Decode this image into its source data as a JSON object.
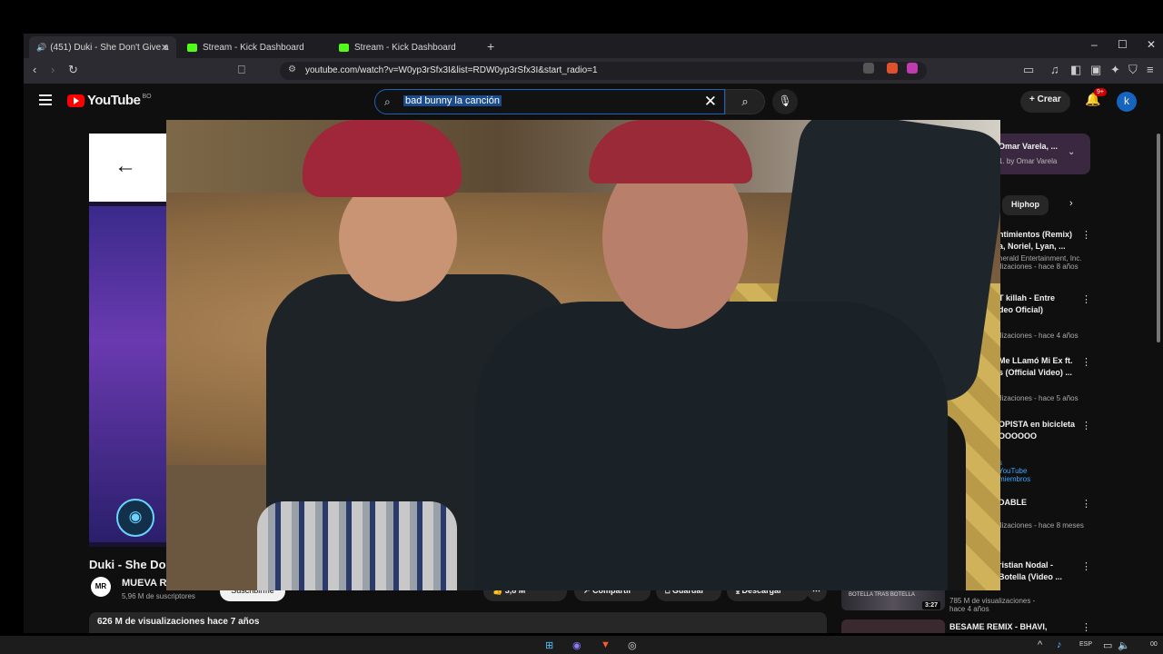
{
  "browser": {
    "tabs": [
      {
        "label": "(451) Duki - She Don't Give a",
        "icon": "youtube-icon",
        "active": true
      },
      {
        "label": "Stream - Kick Dashboard",
        "icon": "kick-icon"
      },
      {
        "label": "Stream - Kick Dashboard",
        "icon": "kick-icon"
      }
    ],
    "new_tab": "+",
    "url": "youtube.com/watch?v=W0yp3rSfx3I&list=RDW0yp3rSfx3I&start_radio=1",
    "window_controls": {
      "minimize": "–",
      "maximize": "☐",
      "close": "✕"
    }
  },
  "youtube": {
    "logo_text": "YouTube",
    "country_code": "BO",
    "search_query": "bad bunny la canción",
    "create_label": "Crear",
    "notif_badge": "9+",
    "avatar_letter": "k"
  },
  "video": {
    "title": "Duki - She Don",
    "channel": "MUEVA Re",
    "channel_logo": "MR",
    "subscribers": "5,96 M de suscriptores",
    "subscribe_label": "Suscribirme",
    "likes": "3,8 M",
    "share_label": "Compartir",
    "save_label": "Guardar",
    "download_label": "Descargar",
    "views_line": "626 M de visualizaciones  hace 7 años"
  },
  "sidebar": {
    "mix_title": "Omar Varela, ...",
    "mix_sub": "1. by Omar Varela",
    "chip": "Hiphop",
    "items": [
      {
        "title": "ntimientos (Remix)\na, Noriel, Lyan, ...",
        "meta": "herald Entertainment, Inc.\nilizaciones - hace 8 años"
      },
      {
        "title": "T killah - Entre\ndeo Oficial)",
        "meta": "ilizaciones - hace 4 años"
      },
      {
        "title": "Me LLamó Mi Ex ft.\ns (Official Video) ...",
        "meta": "ilizaciones - hace 5 años"
      },
      {
        "title": "OPISTA en bicicleta\nOOOOOO",
        "meta": "s\nYouTube\nmiembros"
      },
      {
        "title": "DABLE",
        "meta": "ilizaciones - hace 8 meses"
      },
      {
        "title": "ristian Nodal -\nBotella (Video ...",
        "meta": "785 M de visualizaciones - hace 4 años"
      },
      {
        "title": "BESAME REMIX - BHAVI,",
        "meta": ""
      }
    ],
    "duration": "3:27",
    "thumb_text": "BOTELLA TRAS BOTELLA"
  },
  "taskbar": {
    "lang": "ESP",
    "clock": "00"
  },
  "colors": {
    "youtube_red": "#ff0000",
    "kick_green": "#53fc18",
    "search_border": "#1c62b9",
    "subscribed_green": "#3ea6ff"
  }
}
